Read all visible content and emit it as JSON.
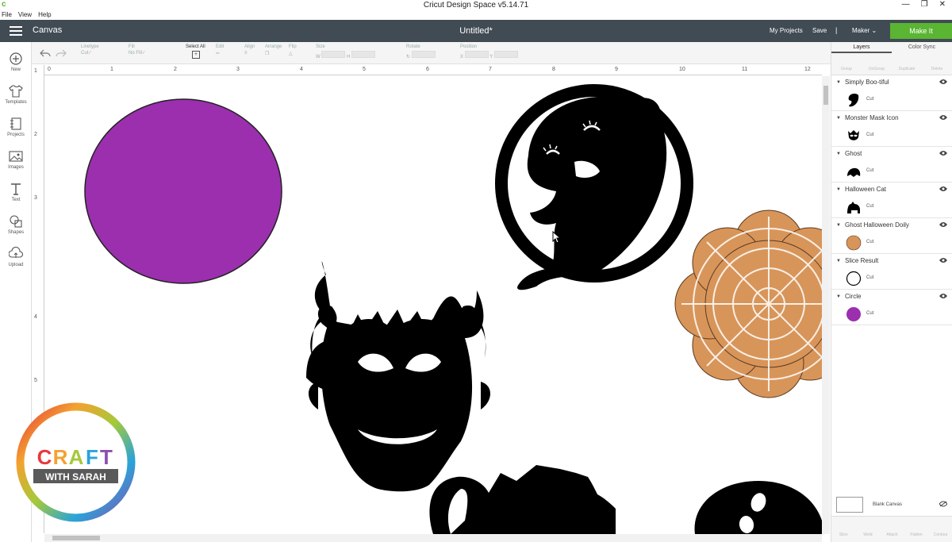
{
  "window": {
    "title": "Cricut Design Space  v5.14.71",
    "app_icon": "c"
  },
  "menu": {
    "items": [
      "File",
      "View",
      "Help"
    ]
  },
  "header": {
    "canvas_label": "Canvas",
    "doc_title": "Untitled*",
    "my_projects": "My Projects",
    "save": "Save",
    "separator": "|",
    "machine": "Maker",
    "make_it": "Make It"
  },
  "rail": {
    "items": [
      {
        "label": "New",
        "icon": "plus-icon"
      },
      {
        "label": "Templates",
        "icon": "shirt-icon"
      },
      {
        "label": "Projects",
        "icon": "projects-icon"
      },
      {
        "label": "Images",
        "icon": "image-icon"
      },
      {
        "label": "Text",
        "icon": "text-icon"
      },
      {
        "label": "Shapes",
        "icon": "shapes-icon"
      },
      {
        "label": "Upload",
        "icon": "upload-icon"
      }
    ]
  },
  "toolbar": {
    "linetype_label": "Linetype",
    "linetype_value": "Cut",
    "fill_label": "Fill",
    "fill_value": "No Fill",
    "select_all": "Select All",
    "edit": "Edit",
    "align": "Align",
    "arrange": "Arrange",
    "flip": "Flip",
    "size": "Size",
    "w": "W",
    "h": "H",
    "rotate": "Rotate",
    "position": "Position",
    "x": "X",
    "y": "Y"
  },
  "ruler": {
    "h_ticks": [
      "0",
      "1",
      "2",
      "3",
      "4",
      "5",
      "6",
      "7",
      "8",
      "9",
      "10",
      "11",
      "12"
    ],
    "v_ticks": [
      "1",
      "2",
      "3",
      "4",
      "5"
    ]
  },
  "panel": {
    "tabs": [
      "Layers",
      "Color Sync"
    ],
    "tools": [
      "Group",
      "UnGroup",
      "Duplicate",
      "Delete"
    ],
    "layers": [
      {
        "name": "Simply Boo-tiful",
        "op": "Cut",
        "color": "#000000"
      },
      {
        "name": "Monster Mask Icon",
        "op": "Cut",
        "color": "#000000"
      },
      {
        "name": "Ghost",
        "op": "Cut",
        "color": "#000000"
      },
      {
        "name": "Halloween Cat",
        "op": "Cut",
        "color": "#000000"
      },
      {
        "name": "Ghost Halloween Doily",
        "op": "Cut",
        "color": "#d8955a"
      },
      {
        "name": "Slice Result",
        "op": "Cut",
        "color": "#ffffff"
      },
      {
        "name": "Circle",
        "op": "Cut",
        "color": "#9b2fae"
      }
    ],
    "blank_canvas": "Blank Canvas",
    "bottom_tools": [
      "Slice",
      "Weld",
      "Attach",
      "Flatten",
      "Contour"
    ]
  },
  "colors": {
    "header": "#414b53",
    "make_it": "#5ab532",
    "circle": "#9b2fae",
    "doily": "#d8955a"
  },
  "logo": {
    "line1": "CRAFT",
    "line2": "WITH SARAH"
  }
}
